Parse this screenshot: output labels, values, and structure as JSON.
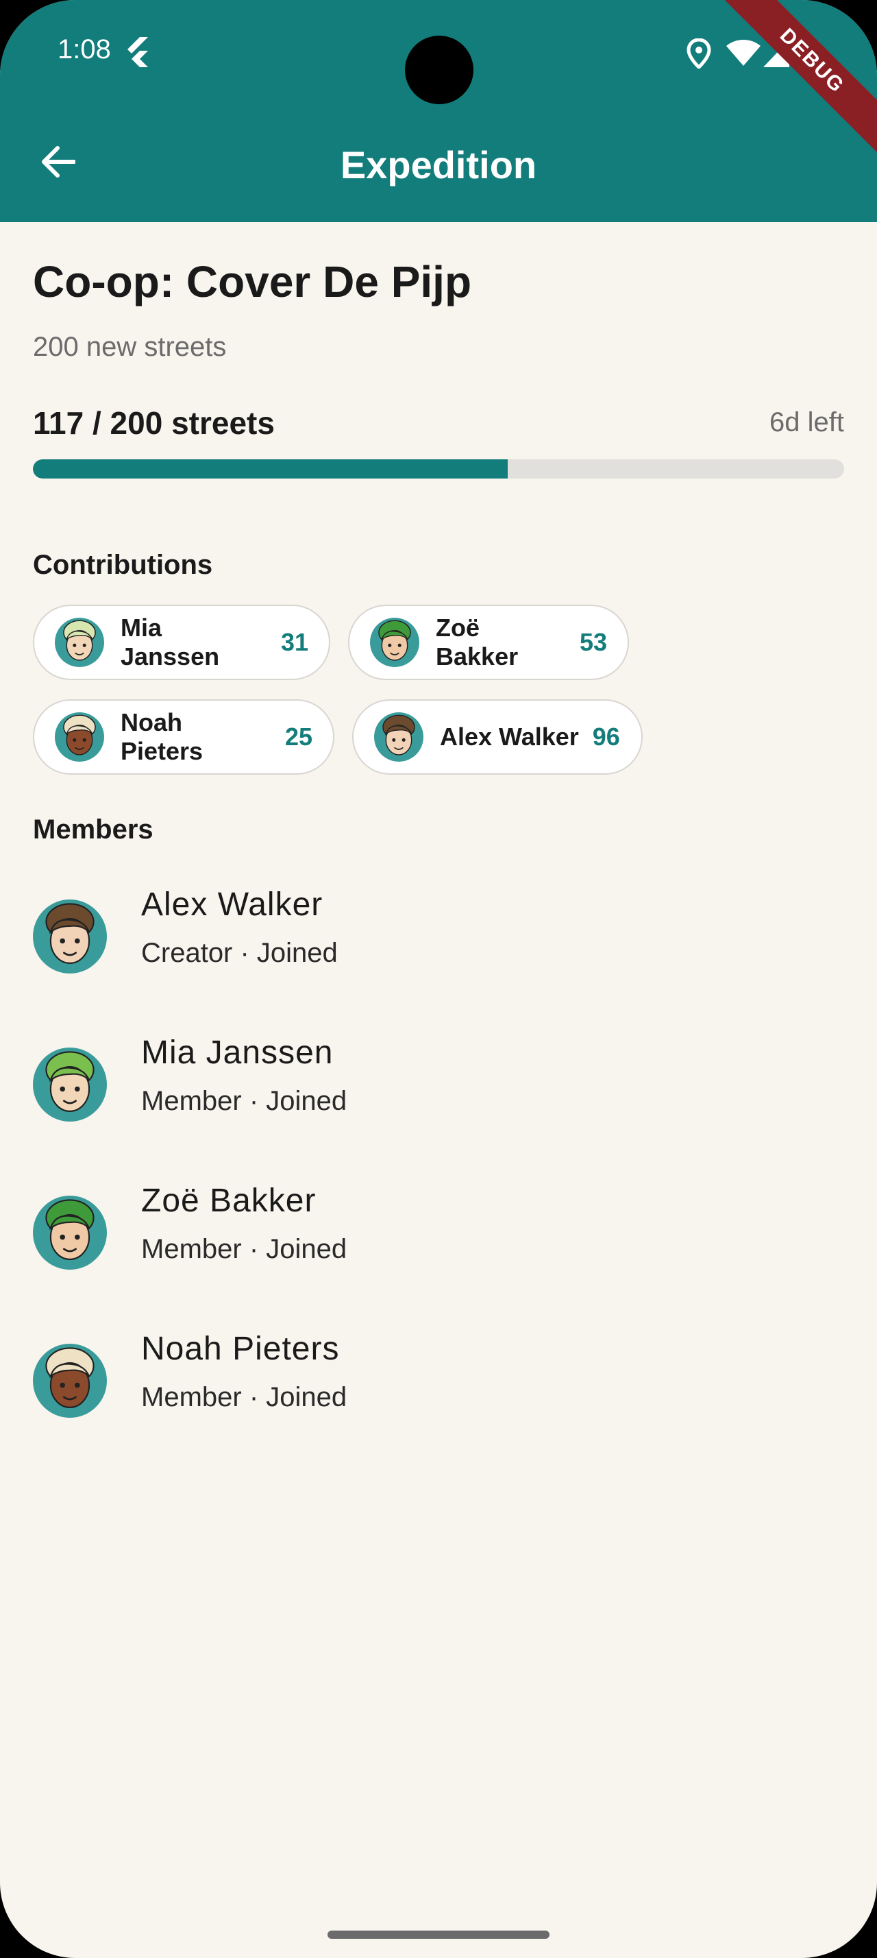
{
  "status_bar": {
    "time": "1:08"
  },
  "app_bar": {
    "title": "Expedition",
    "debug_label": "DEBUG"
  },
  "expedition": {
    "name": "Co-op: Cover De Pijp",
    "subtitle": "200 new streets",
    "progress_label": "117 / 200 streets",
    "progress_fraction": 0.585,
    "time_left": "6d left"
  },
  "contributions": {
    "heading": "Contributions",
    "items": [
      {
        "name": "Mia Janssen",
        "count": "31",
        "hair": "#d8e6b0",
        "skin": "#f2d6b8"
      },
      {
        "name": "Zoë Bakker",
        "count": "53",
        "hair": "#3f9a3a",
        "skin": "#f0c9a6"
      },
      {
        "name": "Noah Pieters",
        "count": "25",
        "hair": "#efe2c4",
        "skin": "#8b4a2b"
      },
      {
        "name": "Alex Walker",
        "count": "96",
        "hair": "#6b4a2e",
        "skin": "#f3d3b8"
      }
    ]
  },
  "members": {
    "heading": "Members",
    "items": [
      {
        "name": "Alex Walker",
        "role": "Creator · Joined",
        "hair": "#6b4a2e",
        "skin": "#f3d3b8"
      },
      {
        "name": "Mia Janssen",
        "role": "Member · Joined",
        "hair": "#7bbf4f",
        "skin": "#f2d6b8"
      },
      {
        "name": "Zoë Bakker",
        "role": "Member · Joined",
        "hair": "#3f9a3a",
        "skin": "#f0c9a6"
      },
      {
        "name": "Noah Pieters",
        "role": "Member · Joined",
        "hair": "#efe2c4",
        "skin": "#8b4a2b"
      }
    ]
  },
  "colors": {
    "accent": "#137d7b",
    "avatar_bg": "#3a9c9a",
    "background": "#f8f4ee"
  }
}
